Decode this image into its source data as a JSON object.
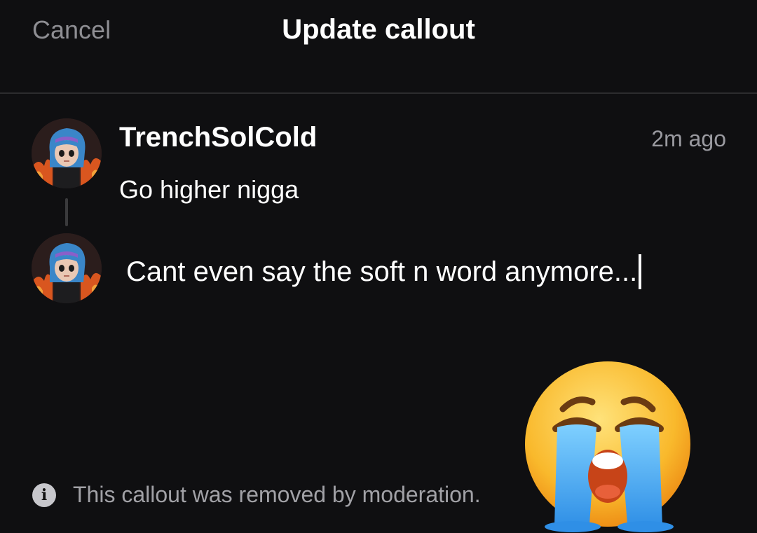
{
  "header": {
    "cancel_label": "Cancel",
    "title": "Update callout"
  },
  "callout": {
    "username": "TrenchSolCold",
    "timestamp": "2m ago",
    "text": "Go higher nigga",
    "avatar_icon": "anime-girl-avatar"
  },
  "reply": {
    "avatar_icon": "anime-girl-avatar",
    "value": "Cant even say the soft n word anymore..."
  },
  "notice": {
    "icon": "info-icon",
    "text": "This callout was removed by moderation."
  },
  "overlay": {
    "emoji": "loudly-crying-face-emoji"
  },
  "colors": {
    "background": "#0f0f11",
    "divider": "#2c2c2e",
    "muted_text": "#8e8e93",
    "primary_text": "#ffffff"
  }
}
